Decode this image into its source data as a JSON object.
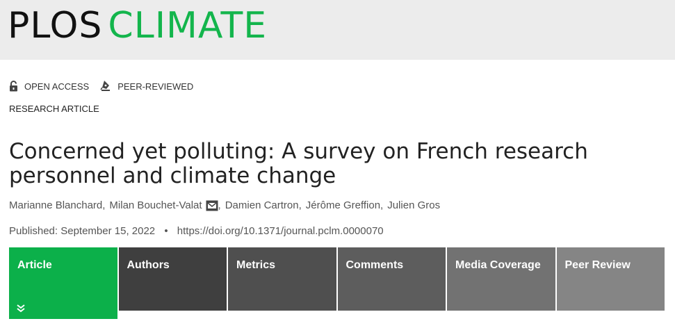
{
  "brand": {
    "logo_part1": "PLOS",
    "logo_part2": "CLIMATE",
    "logo_part1_color": "#111111",
    "logo_part2_color": "#13b54c"
  },
  "badges": [
    {
      "label": "OPEN ACCESS",
      "icon": "open-lock-icon"
    },
    {
      "label": "PEER-REVIEWED",
      "icon": "pen-nib-icon"
    }
  ],
  "article": {
    "type": "RESEARCH ARTICLE",
    "title": "Concerned yet polluting: A survey on French research personnel and climate change",
    "authors": [
      {
        "name": "Marianne Blanchard",
        "email_icon": false
      },
      {
        "name": "Milan Bouchet-Valat",
        "email_icon": true
      },
      {
        "name": "Damien Cartron",
        "email_icon": false
      },
      {
        "name": "Jérôme Greffion",
        "email_icon": false
      },
      {
        "name": "Julien Gros",
        "email_icon": false
      }
    ],
    "author_separator": ",",
    "published_label": "Published: September 15, 2022",
    "bullet": "•",
    "doi": "https://doi.org/10.1371/journal.pclm.0000070"
  },
  "tabs": [
    {
      "label": "Article",
      "active": true,
      "color": "#0cb04a"
    },
    {
      "label": "Authors",
      "active": false,
      "color": "#3f3f3f"
    },
    {
      "label": "Metrics",
      "active": false,
      "color": "#4f4f4f"
    },
    {
      "label": "Comments",
      "active": false,
      "color": "#5d5d5d"
    },
    {
      "label": "Media Coverage",
      "active": false,
      "color": "#727272"
    },
    {
      "label": "Peer Review",
      "active": false,
      "color": "#858585"
    }
  ],
  "colors": {
    "header_background": "#ececec",
    "accent": "#0cb04a"
  }
}
